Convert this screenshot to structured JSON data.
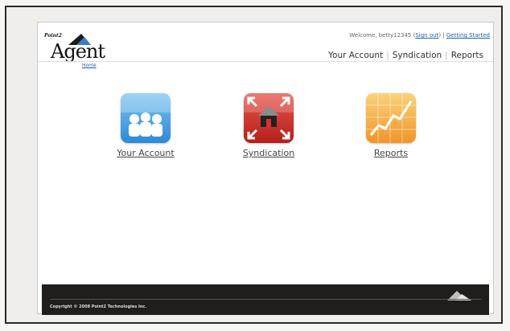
{
  "header": {
    "brand_small": "Point2",
    "brand_main": "Agent",
    "breadcrumb": "Home",
    "welcome_prefix": "Welcome, betty12345 (",
    "sign_out": "Sign out",
    "welcome_mid": ") |",
    "getting_started": "Getting Started",
    "nav": [
      "Your Account",
      "Syndication",
      "Reports"
    ]
  },
  "tiles": [
    {
      "label": "Your Account",
      "icon": "users-icon",
      "color": "#3d9fe0"
    },
    {
      "label": "Syndication",
      "icon": "house-arrows-icon",
      "color": "#d4322a"
    },
    {
      "label": "Reports",
      "icon": "chart-icon",
      "color": "#f4a52a"
    }
  ],
  "footer": {
    "copyright": "Copyright © 2008 Point2 Technologies Inc."
  }
}
